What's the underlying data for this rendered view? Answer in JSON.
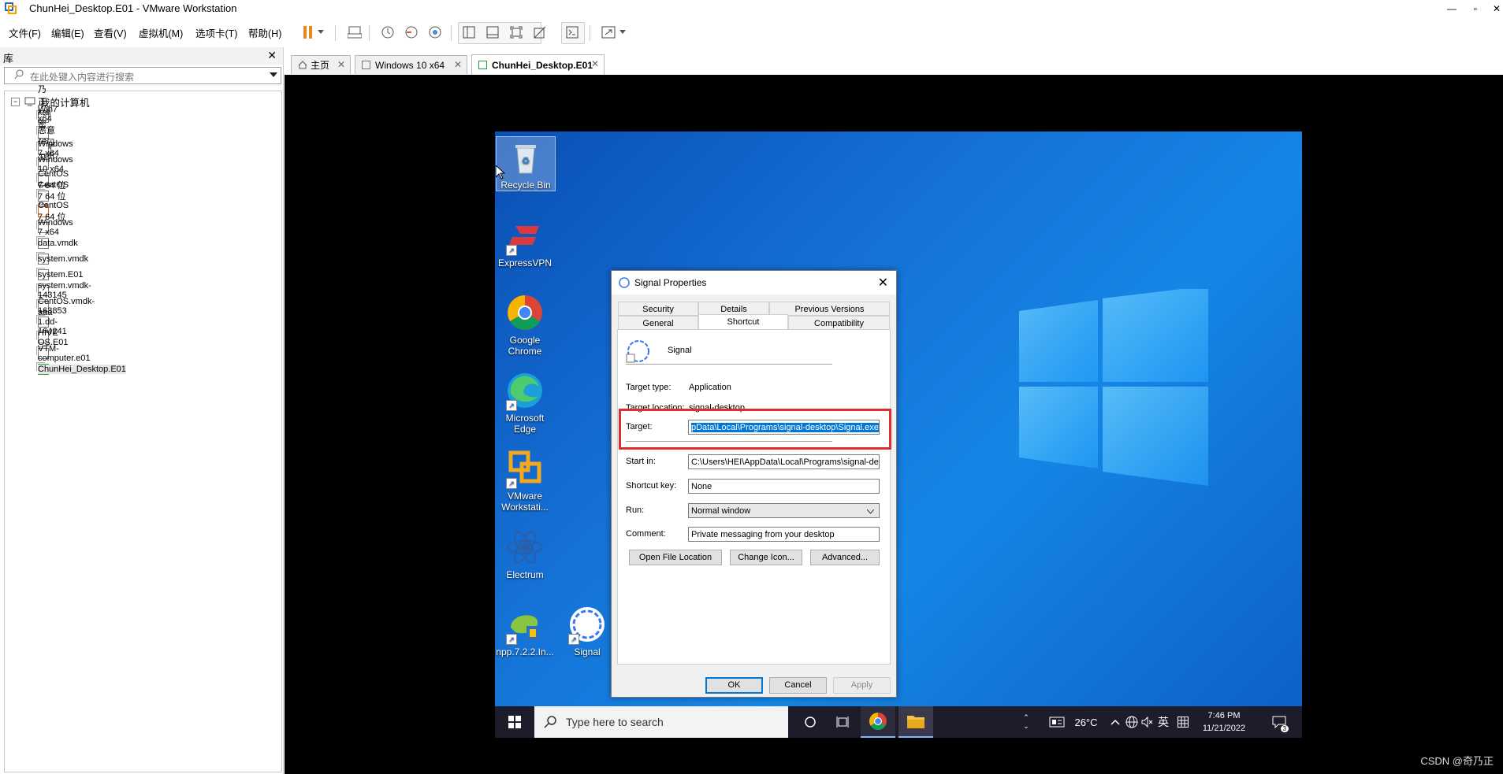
{
  "window": {
    "title": "ChunHei_Desktop.E01 - VMware Workstation",
    "controls": [
      "—",
      "▫",
      "✕"
    ]
  },
  "menu": [
    "文件(F)",
    "编辑(E)",
    "查看(V)",
    "虚拟机(M)",
    "选项卡(T)",
    "帮助(H)"
  ],
  "library": {
    "title": "库",
    "close": "✕",
    "search_placeholder": "在此处键入内容进行搜索",
    "root": "我的计算机",
    "items": [
      "乃正kali 密码toor",
      "Win7 x64 恶意代码分析",
      "Windows 7 x64",
      "Windows 10 x64",
      "CentOS 7 64 位",
      "CentOS 7 64 位 (2)",
      "CentOS 7 64 位",
      "Windows 7 x64",
      "data.vmdk",
      "system.vmdk",
      "system.E01",
      "system.vmdk-143145",
      "CentOS.vmdk-163853",
      "aaa-1.dd-164241",
      "HIVE OS.E01",
      "VTM-computer.e01",
      "ChunHei_Desktop.E01"
    ]
  },
  "tabs": [
    {
      "label": "主页"
    },
    {
      "label": "Windows 10 x64"
    },
    {
      "label": "ChunHei_Desktop.E01"
    }
  ],
  "desktop_icons": [
    {
      "label": "Recycle Bin"
    },
    {
      "label": "ExpressVPN"
    },
    {
      "label": "Google Chrome"
    },
    {
      "label": "Microsoft Edge"
    },
    {
      "label": "VMware Workstati..."
    },
    {
      "label": "Electrum"
    },
    {
      "label": "npp.7.2.2.In..."
    },
    {
      "label": "Signal"
    }
  ],
  "dialog": {
    "title": "Signal Properties",
    "tabs_top": [
      "Security",
      "Details",
      "Previous Versions"
    ],
    "tabs_bottom": [
      "General",
      "Shortcut",
      "Compatibility"
    ],
    "app_name": "Signal",
    "target_type_label": "Target type:",
    "target_type_value": "Application",
    "target_location_label": "Target location:",
    "target_location_value": "signal-desktop",
    "target_label": "Target:",
    "target_value": "pData\\Local\\Programs\\signal-desktop\\Signal.exe",
    "start_in_label": "Start in:",
    "start_in_value": "C:\\Users\\HEI\\AppData\\Local\\Programs\\signal-de",
    "shortcut_key_label": "Shortcut key:",
    "shortcut_key_value": "None",
    "run_label": "Run:",
    "run_value": "Normal window",
    "comment_label": "Comment:",
    "comment_value": "Private messaging from your desktop",
    "btn_open_location": "Open File Location",
    "btn_change_icon": "Change Icon...",
    "btn_advanced": "Advanced...",
    "btn_ok": "OK",
    "btn_cancel": "Cancel",
    "btn_apply": "Apply"
  },
  "taskbar": {
    "search_placeholder": "Type here to search",
    "temperature": "26°C",
    "ime": "英",
    "time": "7:46 PM",
    "date": "11/21/2022",
    "notifications": "3"
  },
  "watermark": "CSDN @奇乃正",
  "colors": {
    "accent": "#0078d7",
    "highlight_box": "#e02e2e",
    "desktop": "#1571d6"
  }
}
